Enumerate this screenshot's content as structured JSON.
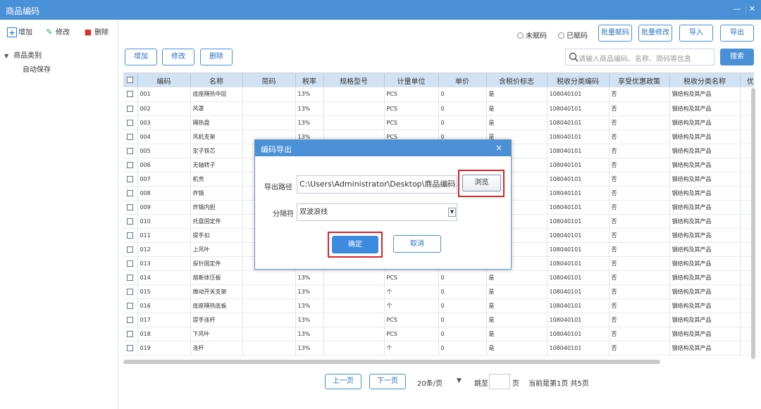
{
  "window": {
    "title": "商品编码",
    "min_icon": "minimize-icon",
    "close_icon": "close-icon"
  },
  "toolbar": {
    "add": "增加",
    "edit": "修改",
    "delete": "删除"
  },
  "tree": {
    "root": "商品类别",
    "children": [
      "自动保存"
    ]
  },
  "filters": {
    "unassigned": "未赋码",
    "assigned": "已赋码"
  },
  "actions": {
    "batch_code": "批量赋码",
    "batch_edit": "批量修改",
    "import": "导入",
    "export": "导出"
  },
  "row_actions": {
    "add": "增加",
    "edit": "修改",
    "delete": "删除"
  },
  "search": {
    "placeholder": "请输入商品编码、名称、简码等信息",
    "button": "搜索"
  },
  "table": {
    "columns": [
      "编码",
      "名称",
      "简码",
      "税率",
      "规格型号",
      "计量单位",
      "单价",
      "含税价标志",
      "税收分类编码",
      "享受优惠政策",
      "税收分类名称",
      "优"
    ],
    "rows": [
      [
        "001",
        "底座隔热中层",
        "",
        "13%",
        "",
        "PCS",
        "0",
        "是",
        "108040101",
        "否",
        "钢结构及其产品",
        ""
      ],
      [
        "002",
        "风罩",
        "",
        "13%",
        "",
        "PCS",
        "0",
        "是",
        "108040101",
        "否",
        "钢结构及其产品",
        ""
      ],
      [
        "003",
        "隔热盘",
        "",
        "13%",
        "",
        "PCS",
        "0",
        "是",
        "108040101",
        "否",
        "钢结构及其产品",
        ""
      ],
      [
        "004",
        "风机支架",
        "",
        "13%",
        "",
        "PCS",
        "0",
        "是",
        "108040101",
        "否",
        "钢结构及其产品",
        ""
      ],
      [
        "005",
        "定子铁芯",
        "",
        "",
        "",
        "",
        "",
        "",
        "108040101",
        "否",
        "钢结构及其产品",
        ""
      ],
      [
        "006",
        "无轴转子",
        "",
        "",
        "",
        "",
        "",
        "",
        "108040101",
        "否",
        "钢结构及其产品",
        ""
      ],
      [
        "007",
        "机壳",
        "",
        "",
        "",
        "",
        "",
        "",
        "108040101",
        "否",
        "钢结构及其产品",
        ""
      ],
      [
        "008",
        "炸锅",
        "",
        "",
        "",
        "",
        "",
        "",
        "108040101",
        "否",
        "钢结构及其产品",
        ""
      ],
      [
        "009",
        "炸锅内胆",
        "",
        "",
        "",
        "",
        "",
        "",
        "108040101",
        "否",
        "钢结构及其产品",
        ""
      ],
      [
        "010",
        "托盘固定件",
        "",
        "",
        "",
        "",
        "",
        "",
        "108040101",
        "否",
        "钢结构及其产品",
        ""
      ],
      [
        "011",
        "提手扣",
        "",
        "",
        "",
        "",
        "",
        "",
        "108040101",
        "否",
        "钢结构及其产品",
        ""
      ],
      [
        "012",
        "上风叶",
        "",
        "",
        "",
        "",
        "",
        "",
        "108040101",
        "否",
        "钢结构及其产品",
        ""
      ],
      [
        "013",
        "探针固定件",
        "",
        "",
        "",
        "",
        "",
        "",
        "108040101",
        "否",
        "钢结构及其产品",
        ""
      ],
      [
        "014",
        "熔断体压板",
        "",
        "13%",
        "",
        "PCS",
        "0",
        "是",
        "108040101",
        "否",
        "钢结构及其产品",
        ""
      ],
      [
        "015",
        "微动开关支架",
        "",
        "13%",
        "",
        "个",
        "0",
        "是",
        "108040101",
        "否",
        "钢结构及其产品",
        ""
      ],
      [
        "016",
        "底座隔热底板",
        "",
        "13%",
        "",
        "个",
        "0",
        "是",
        "108040101",
        "否",
        "钢结构及其产品",
        ""
      ],
      [
        "017",
        "提手连杆",
        "",
        "13%",
        "",
        "PCS",
        "0",
        "是",
        "108040101",
        "否",
        "钢结构及其产品",
        ""
      ],
      [
        "018",
        "下风叶",
        "",
        "13%",
        "",
        "PCS",
        "0",
        "是",
        "108040101",
        "否",
        "钢结构及其产品",
        ""
      ],
      [
        "019",
        "连杆",
        "",
        "13%",
        "",
        "个",
        "0",
        "是",
        "108040101",
        "否",
        "钢结构及其产品",
        ""
      ]
    ]
  },
  "pagination": {
    "prev": "上一页",
    "next": "下一页",
    "page_size": "20条/页",
    "jump": "跳至",
    "page_unit": "页",
    "info": "当前是第1页 共5页"
  },
  "dialog": {
    "title": "编码导出",
    "path_label": "导出路径",
    "path_value": "C:\\Users\\Administrator\\Desktop\\商品编码.txt",
    "browse": "浏览",
    "separator_label": "分隔符",
    "separator_value": "双波浪线",
    "ok": "确定",
    "cancel": "取消"
  },
  "colors": {
    "accent": "#4a90d6",
    "header_bg": "#d3e2f3",
    "highlight": "#d8232a"
  }
}
